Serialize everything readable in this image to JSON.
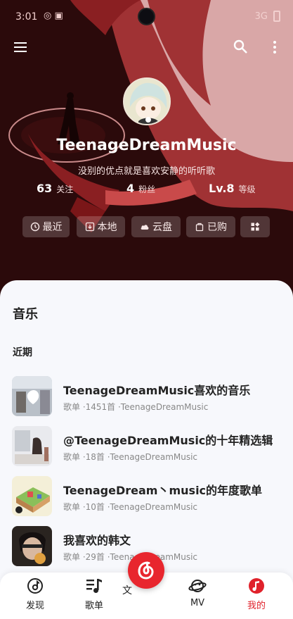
{
  "status_bar": {
    "time": "3:01",
    "network": "3G"
  },
  "header": {
    "username": "TeenageDreamMusic",
    "signature": "没别的优点就是喜欢安静的听听歌"
  },
  "stats": [
    {
      "value": "63",
      "label": "关注"
    },
    {
      "value": "4",
      "label": "粉丝"
    },
    {
      "value": "Lv.8",
      "label": "等级"
    }
  ],
  "quick_actions": [
    {
      "label": "最近",
      "icon": "clock-icon"
    },
    {
      "label": "本地",
      "icon": "download-icon"
    },
    {
      "label": "云盘",
      "icon": "cloud-icon"
    },
    {
      "label": "已购",
      "icon": "bag-icon"
    },
    {
      "label": "",
      "icon": "apps-icon"
    }
  ],
  "content": {
    "section_title": "音乐",
    "sub_title": "近期",
    "playlists": [
      {
        "title": "TeenageDreamMusic喜欢的音乐",
        "meta": "歌单 ·1451首 ·TeenageDreamMusic"
      },
      {
        "title": "@TeenageDreamMusic的十年精选辑",
        "meta": "歌单 ·18首 ·TeenageDreamMusic"
      },
      {
        "title": "TeenageDream丶music的年度歌单",
        "meta": "歌单 ·10首 ·TeenageDreamMusic"
      },
      {
        "title": "我喜欢的韩文",
        "meta": "歌单 ·29首 ·TeenageDreamMusic"
      }
    ]
  },
  "bottom_nav": {
    "items": [
      {
        "label": "发现",
        "icon": "disc-icon"
      },
      {
        "label": "歌单",
        "icon": "music-list-icon"
      },
      {
        "label": "MV",
        "icon": "planet-icon"
      },
      {
        "label": "我的",
        "icon": "music-note-icon"
      }
    ],
    "partial_label": "文",
    "active_index": 3
  },
  "colors": {
    "accent": "#e8262e",
    "hero_bg": "#2b0a0b",
    "sheet_bg": "#f7f8fc"
  }
}
